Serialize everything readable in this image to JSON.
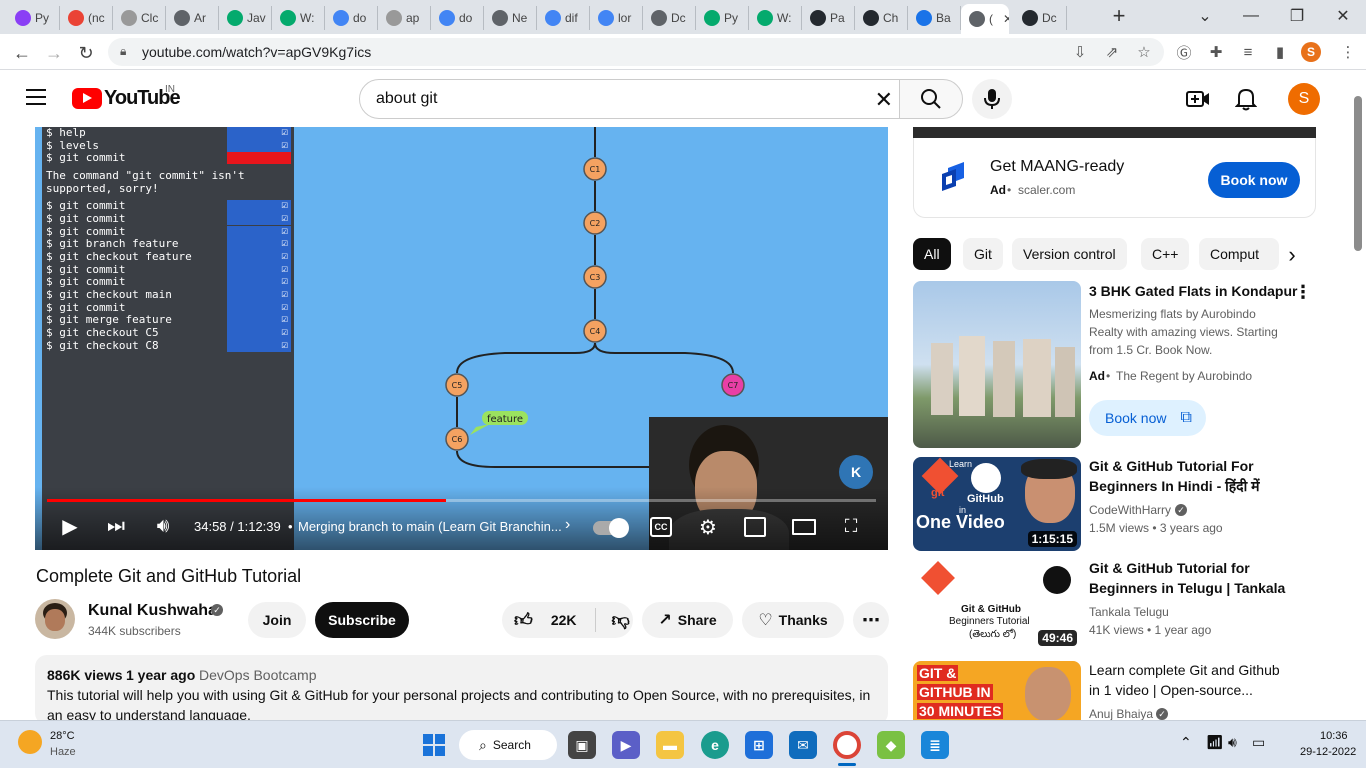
{
  "browser": {
    "tabs": [
      {
        "label": "Py",
        "icon": "tab-favicon-icon",
        "color": "#8a3ff5"
      },
      {
        "label": "(nc",
        "icon": "gmail-icon",
        "color": "#ea4335"
      },
      {
        "label": "Clc",
        "icon": "tab-favicon-icon",
        "color": "#999999"
      },
      {
        "label": "Ar",
        "icon": "globe-icon",
        "color": "#5f6368"
      },
      {
        "label": "Jav",
        "icon": "w3schools-icon",
        "color": "#04aa6d"
      },
      {
        "label": "W:",
        "icon": "w3schools-icon",
        "color": "#04aa6d"
      },
      {
        "label": "do",
        "icon": "google-icon",
        "color": "#4285f4"
      },
      {
        "label": "ap",
        "icon": "tab-favicon-icon",
        "color": "#999999"
      },
      {
        "label": "do",
        "icon": "google-icon",
        "color": "#4285f4"
      },
      {
        "label": "Ne",
        "icon": "globe-icon",
        "color": "#5f6368"
      },
      {
        "label": "dif",
        "icon": "google-icon",
        "color": "#4285f4"
      },
      {
        "label": "lor",
        "icon": "google-icon",
        "color": "#4285f4"
      },
      {
        "label": "Dc",
        "icon": "globe-icon",
        "color": "#5f6368"
      },
      {
        "label": "Py",
        "icon": "w3schools-icon",
        "color": "#04aa6d"
      },
      {
        "label": "W:",
        "icon": "w3schools-icon",
        "color": "#04aa6d"
      },
      {
        "label": "Pa",
        "icon": "github-icon",
        "color": "#24292f"
      },
      {
        "label": "Ch",
        "icon": "github-icon",
        "color": "#24292f"
      },
      {
        "label": "Ba",
        "icon": "tab-favicon-icon",
        "color": "#1a73e8"
      },
      {
        "label": "(",
        "icon": "speaker-icon",
        "color": "#5f6368"
      },
      {
        "label": "Dc",
        "icon": "github-icon",
        "color": "#24292f"
      }
    ],
    "url": "youtube.com/watch?v=apGV9Kg7ics",
    "profile_initial": "S"
  },
  "youtube": {
    "logo_text": "YouTube",
    "region": "IN",
    "search_query": "about git",
    "avatar_initial": "S"
  },
  "video": {
    "terminal_lines": [
      {
        "text": "$ help",
        "check": true
      },
      {
        "text": "$ levels",
        "check": true
      },
      {
        "text": "$ git commit",
        "error": true
      },
      {
        "text": "The command \"git commit\" isn't",
        "plain": true
      },
      {
        "text": "supported, sorry!",
        "plain": true
      },
      {
        "text": "$ git commit",
        "check": true
      },
      {
        "text": "$ git commit",
        "check": true
      },
      {
        "text": "$ git commit",
        "check": true
      },
      {
        "text": "$ git branch feature",
        "check": true
      },
      {
        "text": "$ git checkout feature",
        "check": true
      },
      {
        "text": "$ git commit",
        "check": true
      },
      {
        "text": "$ git commit",
        "check": true
      },
      {
        "text": "$ git checkout main",
        "check": true
      },
      {
        "text": "$ git commit",
        "check": true
      },
      {
        "text": "$ git merge feature",
        "check": true
      },
      {
        "text": "$ git checkout C5",
        "check": true
      },
      {
        "text": "$ git checkout C8",
        "check": true
      }
    ],
    "commits": [
      "C1",
      "C2",
      "C3",
      "C4",
      "C5",
      "C6",
      "C7"
    ],
    "branch_label": "feature",
    "time": "34:58 / 1:12:39",
    "chapter": "Merging branch to main (Learn Git Branchin...",
    "progress": 0.481,
    "title": "Complete Git and GitHub Tutorial"
  },
  "channel": {
    "name": "Kunal Kushwaha",
    "subscribers": "344K subscribers",
    "join_label": "Join",
    "subscribe_label": "Subscribe"
  },
  "actions": {
    "likes": "22K",
    "share_label": "Share",
    "thanks_label": "Thanks"
  },
  "description": {
    "views": "886K views",
    "age": "1 year ago",
    "tag": "DevOps Bootcamp",
    "text_line1": "This tutorial will help you with using Git & GitHub for your personal projects and contributing to Open Source, with no prerequisites, in",
    "text_line2": "an easy to understand language."
  },
  "ad_top": {
    "title": "Get MAANG-ready",
    "ad_label": "Ad",
    "domain": "scaler.com",
    "button": "Book now"
  },
  "chips": [
    "All",
    "Git",
    "Version control",
    "C++",
    "Comput"
  ],
  "recommendations": [
    {
      "title": "3 BHK Gated Flats in Kondapur",
      "desc": [
        "Mesmerizing flats by Aurobindo",
        "Realty with amazing views. Starting",
        "from 1.5 Cr. Book Now."
      ],
      "ad_label": "Ad",
      "advertiser": "The Regent by Aurobindo",
      "button": "Book now"
    },
    {
      "title_lines": [
        "Git & GitHub Tutorial For",
        "Beginners In Hindi - हिंदी में"
      ],
      "channel": "CodeWithHarry",
      "meta": "1.5M views • 3 years ago",
      "duration": "1:15:15",
      "thumb_text": [
        "Learn",
        "git",
        "GitHub",
        "in",
        "One Video"
      ]
    },
    {
      "title_lines": [
        "Git & GitHub Tutorial for",
        "Beginners in Telugu | Tankala"
      ],
      "channel": "Tankala Telugu",
      "meta": "41K views • 1 year ago",
      "duration": "49:46",
      "thumb_text": [
        "Git & GitHub",
        "Beginners Tutorial",
        "(తెలుగు లో)"
      ]
    },
    {
      "title_lines": [
        "Learn complete Git and Github",
        "in 1 video | Open-source..."
      ],
      "channel": "Anuj Bhaiya",
      "thumb_text": [
        "GIT &",
        "GITHUB IN",
        "30 MINUTES"
      ]
    }
  ],
  "taskbar": {
    "temp": "28°C",
    "weather": "Haze",
    "search_label": "Search",
    "time": "10:36",
    "date": "29-12-2022"
  }
}
